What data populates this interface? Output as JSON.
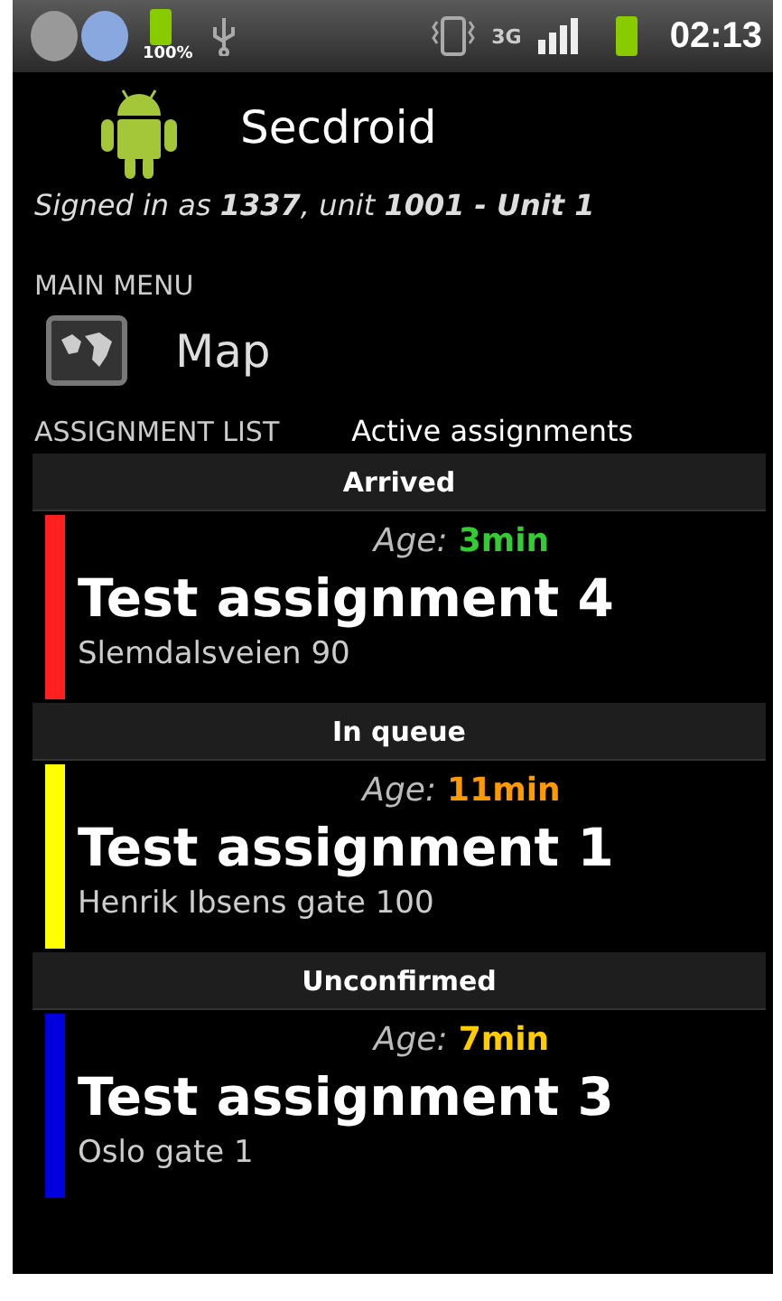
{
  "status_bar": {
    "battery_percent": "100%",
    "network": "3G",
    "time": "02:13"
  },
  "header": {
    "title": "Secdroid",
    "signed_in": "Signed in as **1337**, unit **1001 - Unit 1**"
  },
  "main_menu": {
    "heading": "MAIN MENU",
    "items": [
      {
        "label": "Map"
      }
    ]
  },
  "assignment_list": {
    "heading": "ASSIGNMENT LIST",
    "filter": "Active assignments",
    "groups": [
      {
        "status": "Arrived",
        "color": "#ff2020",
        "age": {
          "label": "Age:",
          "value": "3min",
          "color": "#33cc33"
        },
        "title": "Test assignment 4",
        "address": "Slemdalsveien 90"
      },
      {
        "status": "In queue",
        "color": "#ffff00",
        "age": {
          "label": "Age:",
          "value": "11min",
          "color": "#ff9900"
        },
        "title": "Test assignment 1",
        "address": "Henrik Ibsens gate 100"
      },
      {
        "status": "Unconfirmed",
        "color": "#0000dd",
        "age": {
          "label": "Age:",
          "value": "7min",
          "color": "#ffcc00"
        },
        "title": "Test assignment 3",
        "address": "Oslo gate 1"
      }
    ]
  }
}
